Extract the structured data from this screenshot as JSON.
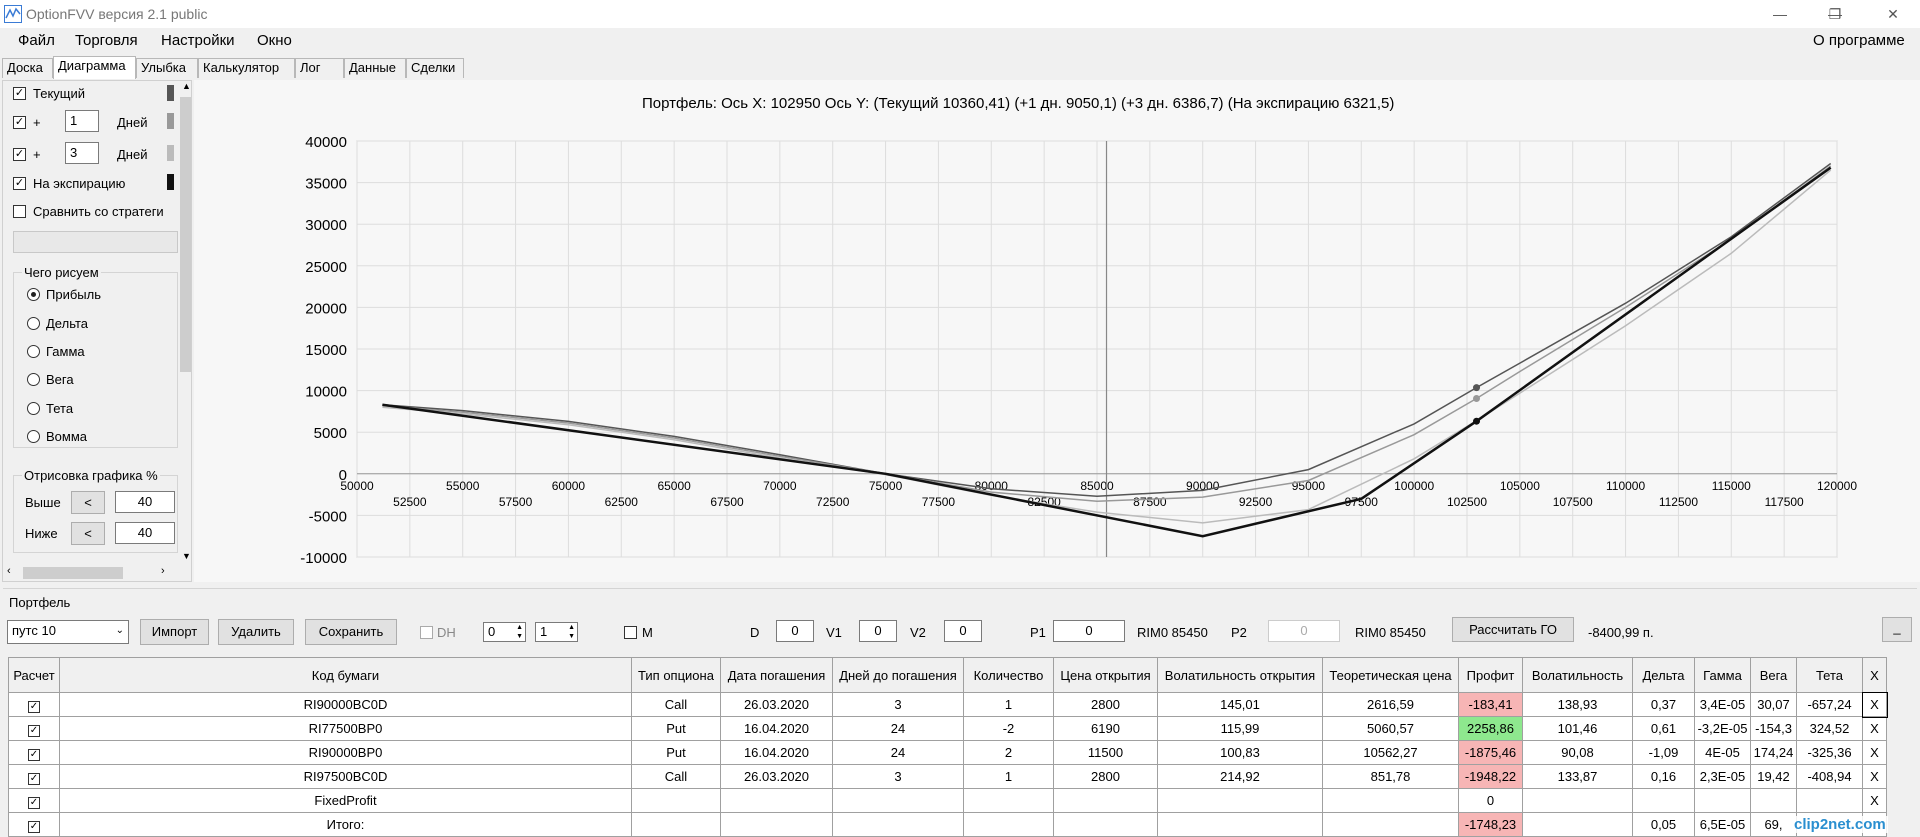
{
  "window": {
    "title": "OptionFVV версия 2.1 public",
    "minimize": "—",
    "maximize": "❐",
    "close": "✕"
  },
  "menu": {
    "file": "Файл",
    "trading": "Торговля",
    "settings": "Настройки",
    "window": "Окно",
    "about": "О программе"
  },
  "tabs": [
    "Доска",
    "Диаграмма",
    "Улыбка",
    "Калькулятор",
    "Лог",
    "Данные",
    "Сделки"
  ],
  "left_panel": {
    "current_label": "Текущий",
    "plus1": "+",
    "days1_value": "1",
    "days1_label": "Дней",
    "plus2": "+",
    "days2_value": "3",
    "days2_label": "Дней",
    "expiry_label": "На экспирацию",
    "compare_label": "Сравнить со стратеги",
    "group_title": "Чего рисуем",
    "radios": [
      "Прибыль",
      "Дельта",
      "Гамма",
      "Вега",
      "Тета",
      "Вомма"
    ],
    "render_title": "Отрисовка графика %",
    "above_label": "Выше",
    "above_value": "40",
    "below_label": "Ниже",
    "below_value": "40",
    "arrow_btn": "<"
  },
  "chart_data": {
    "type": "line",
    "title": "Портфель: Ось X: 102950 Ось Y:  (Текущий 10360,41)  (+1 дн. 9050,1)  (+3 дн. 6386,7)  (На экспирацию 6321,5)",
    "xlim": [
      50000,
      120000
    ],
    "ylim": [
      -10000,
      40000
    ],
    "x_ticks_upper": [
      50000,
      55000,
      60000,
      65000,
      70000,
      75000,
      80000,
      85000,
      90000,
      95000,
      100000,
      105000,
      110000,
      115000,
      120000
    ],
    "x_ticks_lower": [
      52500,
      57500,
      62500,
      67500,
      72500,
      77500,
      82500,
      87500,
      92500,
      97500,
      102500,
      107500,
      112500,
      117500
    ],
    "y_ticks": [
      40000,
      35000,
      30000,
      25000,
      20000,
      15000,
      10000,
      5000,
      0,
      -5000,
      -10000
    ],
    "cursor_x": 85450,
    "marker_x": 102950,
    "series": [
      {
        "name": "Текущий",
        "color": "#555555",
        "x": [
          51200,
          55000,
          60000,
          65000,
          70000,
          75000,
          80000,
          85000,
          90000,
          95000,
          100000,
          102950,
          105000,
          110000,
          115000,
          119700
        ],
        "y": [
          8300,
          7600,
          6300,
          4500,
          2300,
          0,
          -1800,
          -2700,
          -2000,
          500,
          6000,
          10360,
          13300,
          20500,
          28500,
          37300
        ]
      },
      {
        "name": "+1 дн.",
        "color": "#999999",
        "x": [
          51200,
          55000,
          60000,
          65000,
          70000,
          75000,
          80000,
          85000,
          90000,
          95000,
          100000,
          102950,
          105000,
          110000,
          115000,
          119700
        ],
        "y": [
          8200,
          7400,
          6100,
          4300,
          2100,
          0,
          -2200,
          -3300,
          -2800,
          -800,
          4700,
          9050,
          12300,
          20000,
          28200,
          37000
        ]
      },
      {
        "name": "+3 дн.",
        "color": "#bbbbbb",
        "x": [
          51200,
          55000,
          60000,
          65000,
          70000,
          75000,
          80000,
          85000,
          90000,
          95000,
          100000,
          102950,
          105000,
          110000,
          115000,
          119700
        ],
        "y": [
          8000,
          7200,
          5900,
          4100,
          1900,
          -100,
          -2600,
          -4600,
          -5900,
          -4300,
          1800,
          6387,
          9700,
          17800,
          26500,
          36500
        ]
      },
      {
        "name": "На экспирацию",
        "color": "#111111",
        "x": [
          51200,
          75000,
          90000,
          97500,
          102950,
          119700
        ],
        "y": [
          8300,
          0,
          -7500,
          -3000,
          6322,
          36800
        ]
      }
    ]
  },
  "portfolio": {
    "group_title": "Портфель",
    "select_value": "путс 10",
    "import_btn": "Импорт",
    "delete_btn": "Удалить",
    "save_btn": "Сохранить",
    "dh_label": "DH",
    "spin1": "0",
    "spin2": "1",
    "m_label": "M",
    "d_label": "D",
    "d_value": "0",
    "v1_label": "V1",
    "v1_value": "0",
    "v2_label": "V2",
    "v2_value": "0",
    "p1_label": "P1",
    "p1_value": "0",
    "p1_ticker": "RIM0 85450",
    "p2_label": "P2",
    "p2_value": "0",
    "p2_ticker": "RIM0 85450",
    "calc_go_btn": "Рассчитать ГО",
    "go_value": "-8400,99 п.",
    "minimize_btn": "_",
    "columns": [
      "Расчет",
      "Код бумаги",
      "Тип опциона",
      "Дата погашения",
      "Дней до погашения",
      "Количество",
      "Цена открытия",
      "Волатильность открытия",
      "Теоретическая цена",
      "Профит",
      "Волатильность",
      "Дельта",
      "Гамма",
      "Вега",
      "Тета",
      "X"
    ],
    "rows": [
      {
        "code": "RI90000BC0D",
        "type": "Call",
        "date": "26.03.2020",
        "days": "3",
        "qty": "1",
        "price": "2800",
        "vol_open": "145,01",
        "theo": "2616,59",
        "profit": "-183,41",
        "vol": "138,93",
        "delta": "0,37",
        "gamma": "3,4E-05",
        "vega": "30,07",
        "theta": "-657,24",
        "x": "X"
      },
      {
        "code": "RI77500BP0",
        "type": "Put",
        "date": "16.04.2020",
        "days": "24",
        "qty": "-2",
        "price": "6190",
        "vol_open": "115,99",
        "theo": "5060,57",
        "profit": "2258,86",
        "vol": "101,46",
        "delta": "0,61",
        "gamma": "-3,2E-05",
        "vega": "-154,3",
        "theta": "324,52",
        "x": "X"
      },
      {
        "code": "RI90000BP0",
        "type": "Put",
        "date": "16.04.2020",
        "days": "24",
        "qty": "2",
        "price": "11500",
        "vol_open": "100,83",
        "theo": "10562,27",
        "profit": "-1875,46",
        "vol": "90,08",
        "delta": "-1,09",
        "gamma": "4E-05",
        "vega": "174,24",
        "theta": "-325,36",
        "x": "X"
      },
      {
        "code": "RI97500BC0D",
        "type": "Call",
        "date": "26.03.2020",
        "days": "3",
        "qty": "1",
        "price": "2800",
        "vol_open": "214,92",
        "theo": "851,78",
        "profit": "-1948,22",
        "vol": "133,87",
        "delta": "0,16",
        "gamma": "2,3E-05",
        "vega": "19,42",
        "theta": "-408,94",
        "x": "X"
      },
      {
        "code": "FixedProfit",
        "type": "",
        "date": "",
        "days": "",
        "qty": "",
        "price": "",
        "vol_open": "",
        "theo": "",
        "profit": "0",
        "vol": "",
        "delta": "",
        "gamma": "",
        "vega": "",
        "theta": "",
        "x": "X"
      },
      {
        "code": "Итого:",
        "type": "",
        "date": "",
        "days": "",
        "qty": "",
        "price": "",
        "vol_open": "",
        "theo": "",
        "profit": "-1748,23",
        "vol": "",
        "delta": "0,05",
        "gamma": "6,5E-05",
        "vega": "69,",
        "theta": "",
        "x": ""
      }
    ]
  },
  "watermark": "clip2net.com"
}
